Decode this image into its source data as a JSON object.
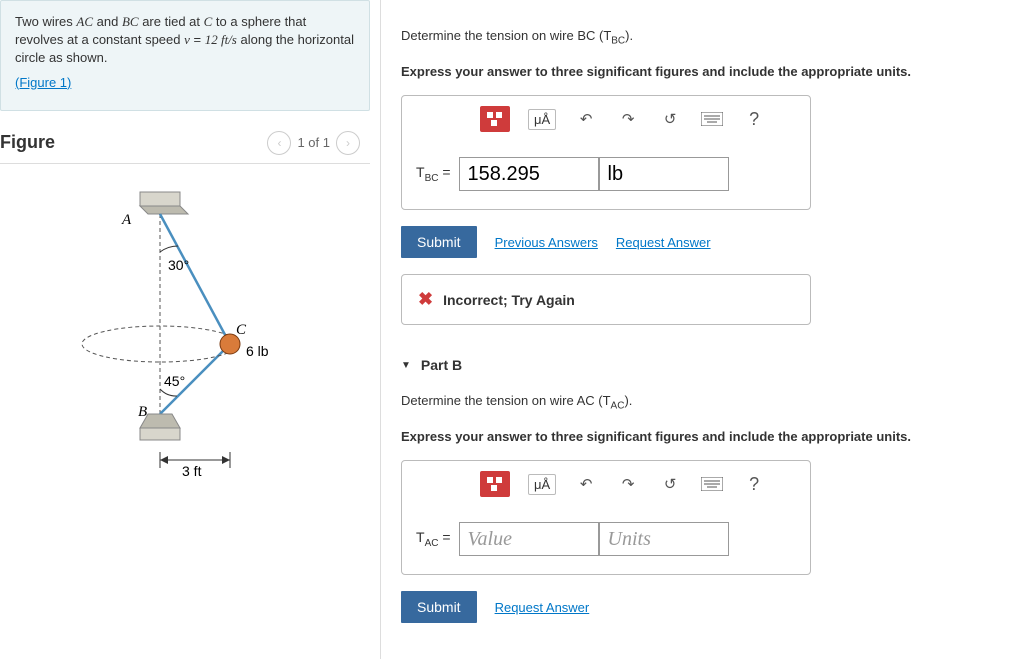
{
  "problem": {
    "line1_a": "Two wires ",
    "line1_b": " and ",
    "line1_c": " are tied at ",
    "line1_d": " to a sphere that revolves at a constant speed ",
    "var_ac": "AC",
    "var_bc": "BC",
    "var_c": "C",
    "var_v": "v",
    "eq": " = ",
    "speed": "12  ft/s",
    "line1_e": " along the horizontal circle as shown.",
    "figure_link": "(Figure 1)"
  },
  "figure": {
    "title": "Figure",
    "pager": "1 of 1",
    "labels": {
      "A": "A",
      "B": "B",
      "C": "C",
      "angle30": "30°",
      "angle45": "45°",
      "weight": "6 lb",
      "dist": "3 ft"
    }
  },
  "partA": {
    "question_a": "Determine the tension on wire BC (T",
    "question_sub": "BC",
    "question_b": ").",
    "instruction": "Express your answer to three significant figures and include the appropriate units.",
    "var_label_a": "T",
    "var_label_sub": "BC",
    "var_label_b": " = ",
    "value": "158.295",
    "units": "lb",
    "submit": "Submit",
    "prev_answers": "Previous Answers",
    "request_answer": "Request Answer",
    "feedback": "Incorrect; Try Again",
    "toolbar": {
      "units_btn": "μÅ",
      "help": "?"
    }
  },
  "partB": {
    "header": "Part B",
    "question_a": "Determine the tension on wire AC (T",
    "question_sub": "AC",
    "question_b": ").",
    "instruction": "Express your answer to three significant figures and include the appropriate units.",
    "var_label_a": "T",
    "var_label_sub": "AC",
    "var_label_b": " = ",
    "value_placeholder": "Value",
    "units_placeholder": "Units",
    "submit": "Submit",
    "request_answer": "Request Answer",
    "toolbar": {
      "units_btn": "μÅ",
      "help": "?"
    }
  }
}
